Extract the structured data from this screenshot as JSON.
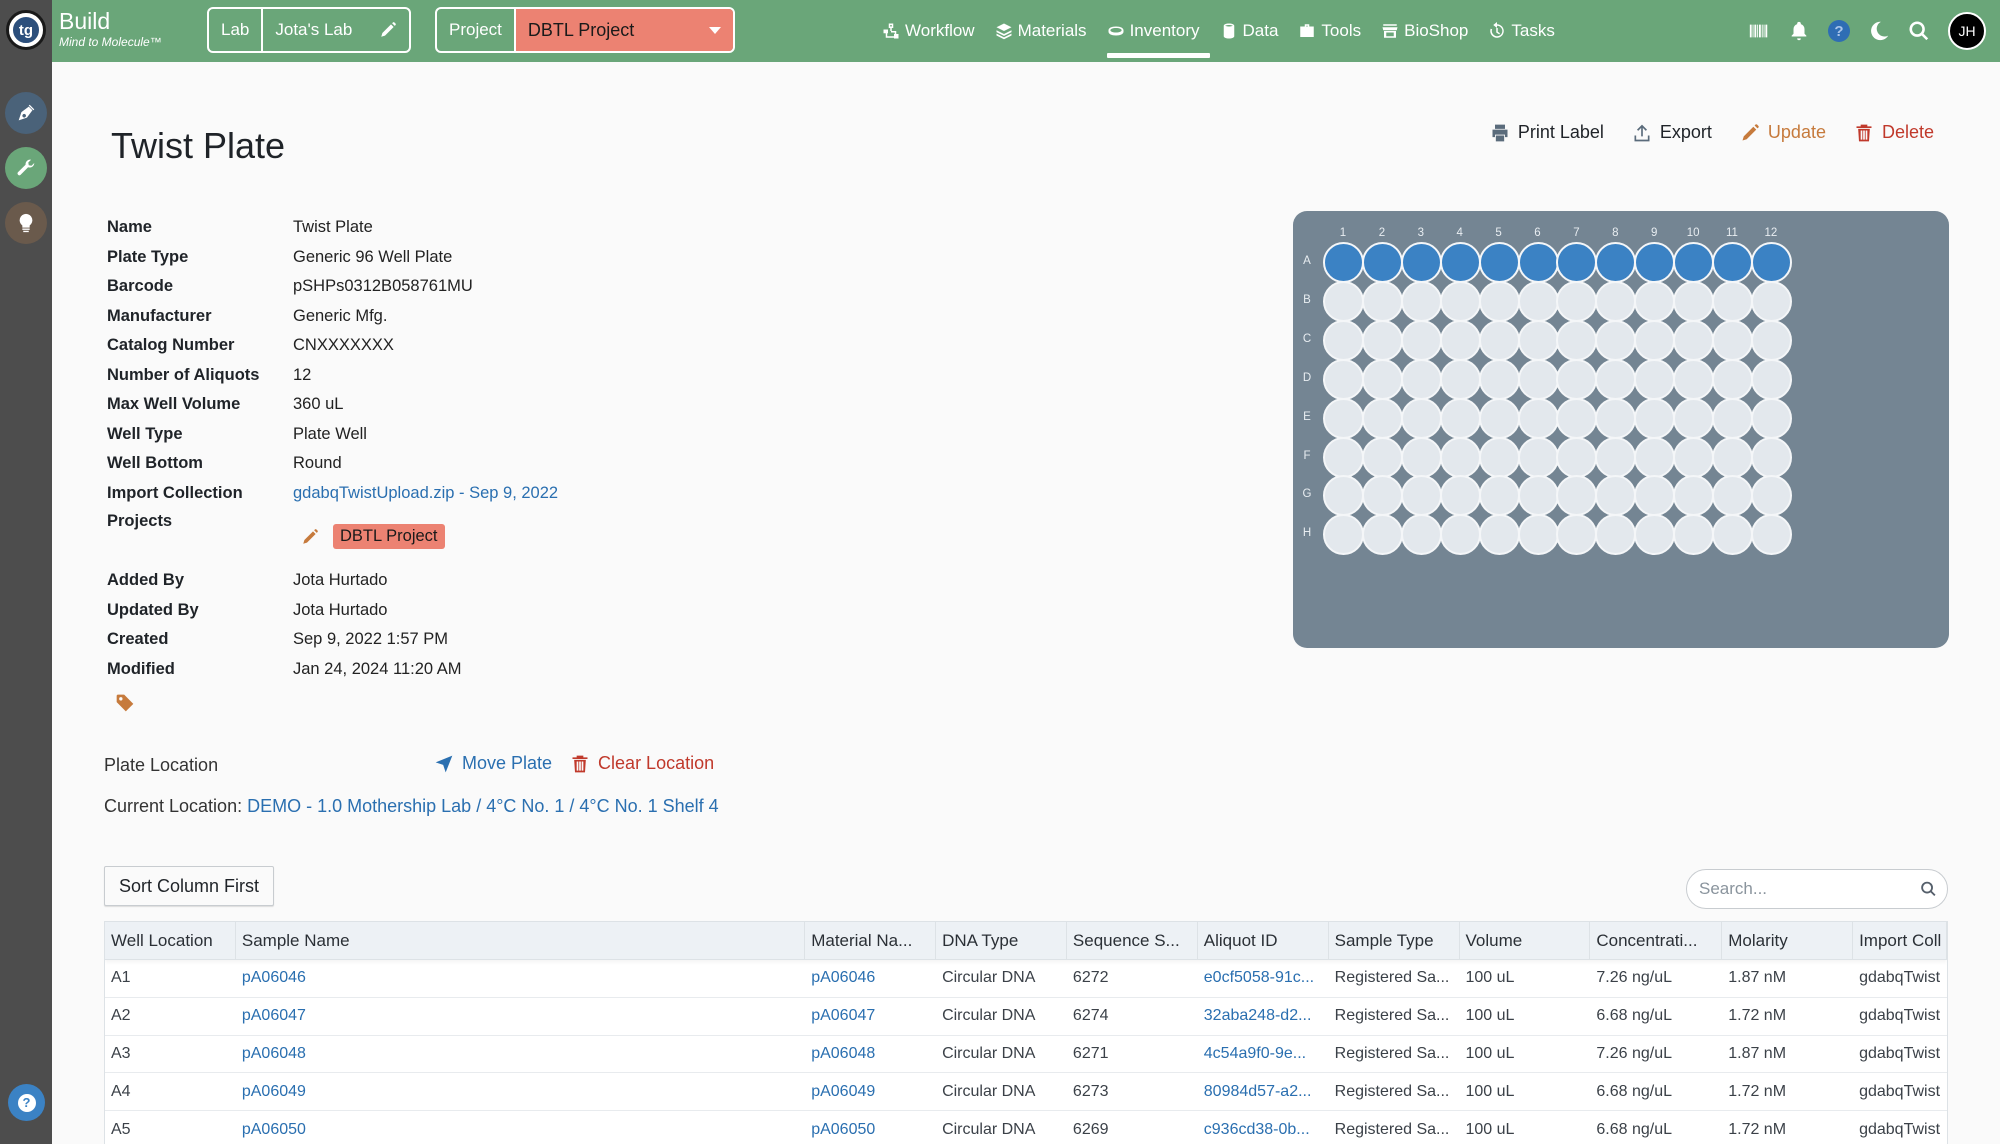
{
  "brand": {
    "title": "Build",
    "subtitle": "Mind to Molecule™",
    "logo_text": "tg"
  },
  "header": {
    "lab_label": "Lab",
    "lab_value": "Jota's Lab",
    "project_label": "Project",
    "project_value": "DBTL Project",
    "nav": [
      {
        "label": "Workflow",
        "icon": "workflow-icon"
      },
      {
        "label": "Materials",
        "icon": "layers-icon"
      },
      {
        "label": "Inventory",
        "icon": "inventory-icon",
        "active": true
      },
      {
        "label": "Data",
        "icon": "database-icon"
      },
      {
        "label": "Tools",
        "icon": "toolbox-icon"
      },
      {
        "label": "BioShop",
        "icon": "store-icon"
      },
      {
        "label": "Tasks",
        "icon": "history-icon"
      }
    ],
    "help_glyph": "?",
    "avatar_initials": "JH"
  },
  "colors": {
    "topbar": "#6aa679",
    "project_accent": "#ec8272",
    "well_filled": "#3b82c4",
    "well_empty": "#e3e8ed",
    "plate": "#748593",
    "link": "#2a6fb0"
  },
  "page": {
    "title": "Twist Plate",
    "actions": {
      "print": "Print Label",
      "export": "Export",
      "update": "Update",
      "delete": "Delete"
    }
  },
  "details": [
    {
      "label": "Name",
      "value": "Twist Plate"
    },
    {
      "label": "Plate Type",
      "value": "Generic 96 Well Plate"
    },
    {
      "label": "Barcode",
      "value": "pSHPs0312B058761MU"
    },
    {
      "label": "Manufacturer",
      "value": "Generic Mfg."
    },
    {
      "label": "Catalog Number",
      "value": "CNXXXXXXX"
    },
    {
      "label": "Number of Aliquots",
      "value": "12"
    },
    {
      "label": "Max Well Volume",
      "value": "360 uL"
    },
    {
      "label": "Well Type",
      "value": "Plate Well"
    },
    {
      "label": "Well Bottom",
      "value": "Round"
    },
    {
      "label": "Import Collection",
      "value": "gdabqTwistUpload.zip - Sep 9, 2022"
    }
  ],
  "projects": {
    "label": "Projects",
    "tags": [
      "DBTL Project"
    ]
  },
  "audit": [
    {
      "label": "Added By",
      "value": "Jota Hurtado"
    },
    {
      "label": "Updated By",
      "value": "Jota Hurtado"
    },
    {
      "label": "Created",
      "value": "Sep 9, 2022 1:57 PM"
    },
    {
      "label": "Modified",
      "value": "Jan 24, 2024 11:20 AM"
    }
  ],
  "location": {
    "label": "Plate Location",
    "move": "Move Plate",
    "clear": "Clear Location",
    "current_prefix": "Current Location:",
    "current_path": "DEMO - 1.0 Mothership Lab / 4°C No. 1 / 4°C No. 1 Shelf 4"
  },
  "plate": {
    "columns": [
      "1",
      "2",
      "3",
      "4",
      "5",
      "6",
      "7",
      "8",
      "9",
      "10",
      "11",
      "12"
    ],
    "rows": [
      "A",
      "B",
      "C",
      "D",
      "E",
      "F",
      "G",
      "H"
    ],
    "filled_wells": [
      "A1",
      "A2",
      "A3",
      "A4",
      "A5",
      "A6",
      "A7",
      "A8",
      "A9",
      "A10",
      "A11",
      "A12"
    ]
  },
  "table": {
    "sort_button": "Sort Column First",
    "search_placeholder": "Search...",
    "columns": [
      "Well Location",
      "Sample Name",
      "Material Na...",
      "DNA Type",
      "Sequence S...",
      "Aliquot ID",
      "Sample Type",
      "Volume",
      "Concentrati...",
      "Molarity",
      "Import Coll"
    ],
    "rows": [
      [
        "A1",
        "pA06046",
        "pA06046",
        "Circular DNA",
        "6272",
        "e0cf5058-91c...",
        "Registered Sa...",
        "100 uL",
        "7.26 ng/uL",
        "1.87 nM",
        "gdabqTwist"
      ],
      [
        "A2",
        "pA06047",
        "pA06047",
        "Circular DNA",
        "6274",
        "32aba248-d2...",
        "Registered Sa...",
        "100 uL",
        "6.68 ng/uL",
        "1.72 nM",
        "gdabqTwist"
      ],
      [
        "A3",
        "pA06048",
        "pA06048",
        "Circular DNA",
        "6271",
        "4c54a9f0-9e...",
        "Registered Sa...",
        "100 uL",
        "7.26 ng/uL",
        "1.87 nM",
        "gdabqTwist"
      ],
      [
        "A4",
        "pA06049",
        "pA06049",
        "Circular DNA",
        "6273",
        "80984d57-a2...",
        "Registered Sa...",
        "100 uL",
        "6.68 ng/uL",
        "1.72 nM",
        "gdabqTwist"
      ],
      [
        "A5",
        "pA06050",
        "pA06050",
        "Circular DNA",
        "6269",
        "c936cd38-0b...",
        "Registered Sa...",
        "100 uL",
        "6.68 ng/uL",
        "1.72 nM",
        "gdabqTwist"
      ]
    ]
  }
}
